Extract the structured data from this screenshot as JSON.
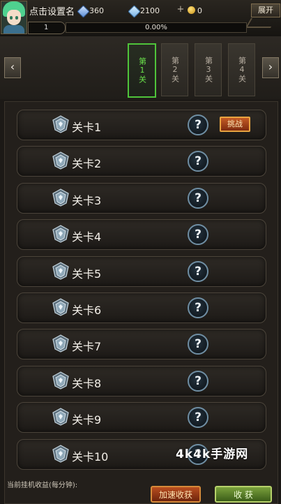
{
  "header": {
    "player_name": "点击设置名",
    "stat1_value": "360",
    "stat2_value": "2100",
    "coin_value": "0",
    "expand_label": "展开",
    "level": "1",
    "xp_text": "0.00%",
    "xp_progress": 0,
    "colors": {
      "gem": "#6f9fe0",
      "coin": "#e0b030",
      "accent_green": "#4fc43a"
    }
  },
  "tabs": {
    "prev_label": "‹",
    "next_label": "›",
    "items": [
      {
        "label": "第1关",
        "active": true
      },
      {
        "label": "第2关",
        "active": false
      },
      {
        "label": "第3关",
        "active": false
      },
      {
        "label": "第4关",
        "active": false
      }
    ]
  },
  "levels": {
    "icon": "shield-emblem-icon",
    "question_icon": "question-mark-icon",
    "challenge_label": "挑战",
    "items": [
      "关卡1",
      "关卡2",
      "关卡3",
      "关卡4",
      "关卡5",
      "关卡6",
      "关卡7",
      "关卡8",
      "关卡9",
      "关卡10"
    ]
  },
  "footer": {
    "income_label": "当前挂机收益(每分钟):",
    "speed_label": "加速收获",
    "collect_label": "收 获"
  },
  "watermark": "4k4k手游网"
}
